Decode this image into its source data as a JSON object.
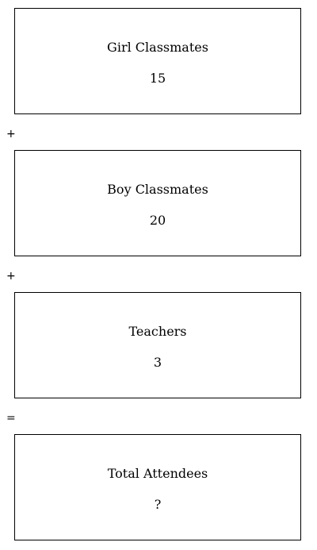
{
  "boxes": [
    {
      "label": "Girl Classmates",
      "value": "15"
    },
    {
      "label": "Boy Classmates",
      "value": "20"
    },
    {
      "label": "Teachers",
      "value": "3"
    },
    {
      "label": "Total Attendees",
      "value": "?"
    }
  ],
  "operators": [
    "+",
    "+",
    "="
  ],
  "colors": {
    "border": "#000000",
    "background": "#ffffff",
    "text": "#000000"
  }
}
